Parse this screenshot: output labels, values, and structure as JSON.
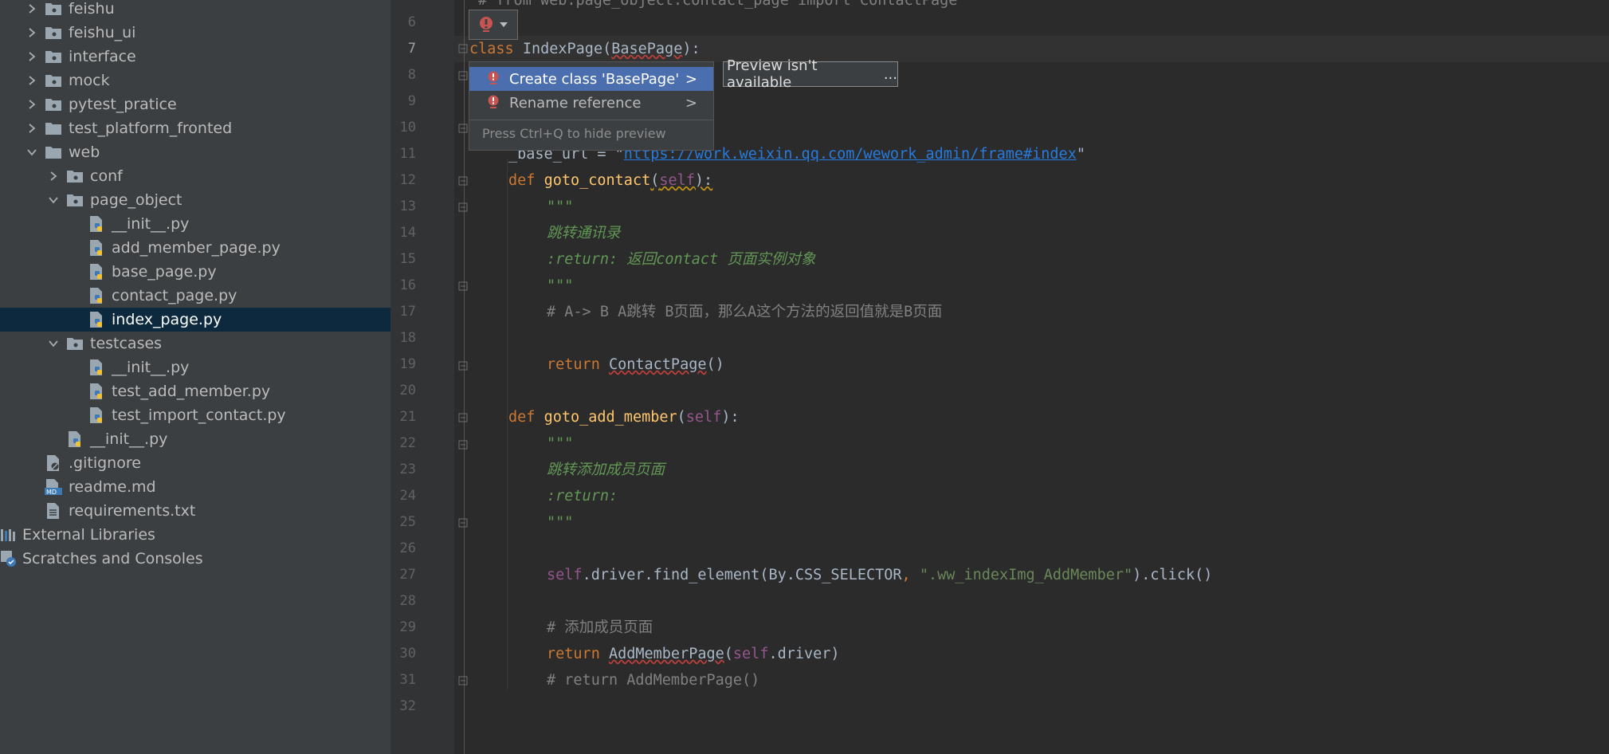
{
  "project_tree": [
    {
      "label": "feishu",
      "type": "folder",
      "depth": 1,
      "expanded": false
    },
    {
      "label": "feishu_ui",
      "type": "folder",
      "depth": 1,
      "expanded": false
    },
    {
      "label": "interface",
      "type": "folder",
      "depth": 1,
      "expanded": false
    },
    {
      "label": "mock",
      "type": "folder",
      "depth": 1,
      "expanded": false
    },
    {
      "label": "pytest_pratice",
      "type": "folder",
      "depth": 1,
      "expanded": false
    },
    {
      "label": "test_platform_fronted",
      "type": "folder",
      "depth": 1,
      "expanded": false
    },
    {
      "label": "web",
      "type": "folder",
      "depth": 1,
      "expanded": true
    },
    {
      "label": "conf",
      "type": "folder",
      "depth": 2,
      "expanded": false
    },
    {
      "label": "page_object",
      "type": "folder",
      "depth": 2,
      "expanded": true
    },
    {
      "label": "__init__.py",
      "type": "python",
      "depth": 3
    },
    {
      "label": "add_member_page.py",
      "type": "python",
      "depth": 3
    },
    {
      "label": "base_page.py",
      "type": "python",
      "depth": 3
    },
    {
      "label": "contact_page.py",
      "type": "python",
      "depth": 3
    },
    {
      "label": "index_page.py",
      "type": "python",
      "depth": 3,
      "selected": true
    },
    {
      "label": "testcases",
      "type": "folder",
      "depth": 2,
      "expanded": true
    },
    {
      "label": "__init__.py",
      "type": "python",
      "depth": 3
    },
    {
      "label": "test_add_member.py",
      "type": "python",
      "depth": 3
    },
    {
      "label": "test_import_contact.py",
      "type": "python",
      "depth": 3
    },
    {
      "label": "__init__.py",
      "type": "python",
      "depth": 2
    },
    {
      "label": ".gitignore",
      "type": "gitignore",
      "depth": 1
    },
    {
      "label": "readme.md",
      "type": "markdown",
      "depth": 1
    },
    {
      "label": "requirements.txt",
      "type": "text",
      "depth": 1
    },
    {
      "label": "External Libraries",
      "type": "libraries",
      "depth": 0
    },
    {
      "label": "Scratches and Consoles",
      "type": "scratches",
      "depth": 0
    }
  ],
  "line_numbers": [
    "6",
    "7",
    "8",
    "9",
    "10",
    "11",
    "12",
    "13",
    "14",
    "15",
    "16",
    "17",
    "18",
    "19",
    "20",
    "21",
    "22",
    "23",
    "24",
    "25",
    "26",
    "27",
    "28",
    "29",
    "30",
    "31",
    "32"
  ],
  "code": {
    "line5_partial": "# from web.page_object.contact_page import ContactPage",
    "line7": {
      "kw": "class",
      "space": " ",
      "name": "IndexPage",
      "open": "(",
      "base": "BasePage",
      "close": "):"
    },
    "line11": {
      "pre": "_base_url = \"",
      "url": "https://work.weixin.qq.com/wework_admin/frame#index",
      "post": "\""
    },
    "line12": {
      "kw": "def",
      "name": "goto_contact",
      "open": "(",
      "self": "self",
      "close": "):"
    },
    "line13": "\"\"\"",
    "line14": "跳转通讯录",
    "line15": ":return: 返回contact 页面实例对象",
    "line16": "\"\"\"",
    "line17": "# A-> B A跳转 B页面，那么A这个方法的返回值就是B页面",
    "line19": {
      "kw": "return",
      "name": "ContactPage",
      "call": "()"
    },
    "line21": {
      "kw": "def",
      "name": "goto_add_member",
      "open": "(",
      "self": "self",
      "close": "):"
    },
    "line22": "\"\"\"",
    "line23": "跳转添加成员页面",
    "line24": ":return:",
    "line25": "\"\"\"",
    "line27": {
      "self": "self",
      "mid": ".driver.find_element(By.CSS_SELECTOR",
      "comma": ", ",
      "str": "\".ww_indexImg_AddMember\"",
      "end": ").click()"
    },
    "line29": "# 添加成员页面",
    "line30": {
      "kw": "return",
      "name": "AddMemberPage",
      "open": "(",
      "self": "self",
      "end": ".driver)"
    },
    "line31": "# return AddMemberPage()"
  },
  "intention_popup": {
    "items": [
      {
        "label": "Create class 'BasePage'",
        "selected": true,
        "icon": "error-bulb-icon"
      },
      {
        "label": "Rename reference",
        "selected": false,
        "icon": "error-bulb-icon"
      }
    ],
    "hint": "Press Ctrl+Q to hide preview",
    "submenu_arrow": ">"
  },
  "preview_box": {
    "text": "Preview isn't available",
    "ellipsis": "..."
  },
  "colors": {
    "sidebar_bg": "#3c3f41",
    "editor_bg": "#2b2b2b",
    "selection": "#0d293e",
    "keyword": "#cc7832",
    "function": "#ffc66d",
    "self": "#94558d",
    "string": "#6a8759",
    "docstring": "#629755",
    "comment": "#808080",
    "menu_selected": "#4b6eaf",
    "error": "#bc3f3c"
  }
}
